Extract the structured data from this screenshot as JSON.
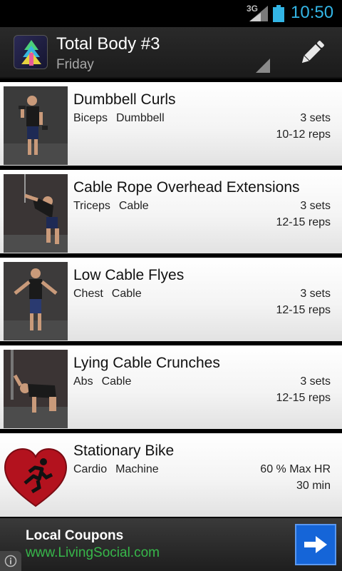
{
  "status_bar": {
    "network": "3G",
    "time": "10:50"
  },
  "header": {
    "title": "Total Body #3",
    "subtitle": "Friday"
  },
  "exercises": [
    {
      "name": "Dumbbell Curls",
      "muscle": "Biceps",
      "equipment": "Dumbbell",
      "sets": "3 sets",
      "reps": "10-12 reps"
    },
    {
      "name": "Cable Rope Overhead Extensions",
      "muscle": "Triceps",
      "equipment": "Cable",
      "sets": "3 sets",
      "reps": "12-15 reps"
    },
    {
      "name": "Low Cable Flyes",
      "muscle": "Chest",
      "equipment": "Cable",
      "sets": "3 sets",
      "reps": "12-15 reps"
    },
    {
      "name": "Lying Cable Crunches",
      "muscle": "Abs",
      "equipment": "Cable",
      "sets": "3 sets",
      "reps": "12-15 reps"
    },
    {
      "name": "Stationary Bike",
      "muscle": "Cardio",
      "equipment": "Machine",
      "sets": "60 % Max HR",
      "reps": "30 min"
    }
  ],
  "ad": {
    "title": "Local Coupons",
    "url": "www.LivingSocial.com"
  },
  "colors": {
    "accent": "#33b5e5",
    "ad_link": "#37b74a",
    "ad_button": "#1565d8",
    "heart": "#b3121e"
  }
}
